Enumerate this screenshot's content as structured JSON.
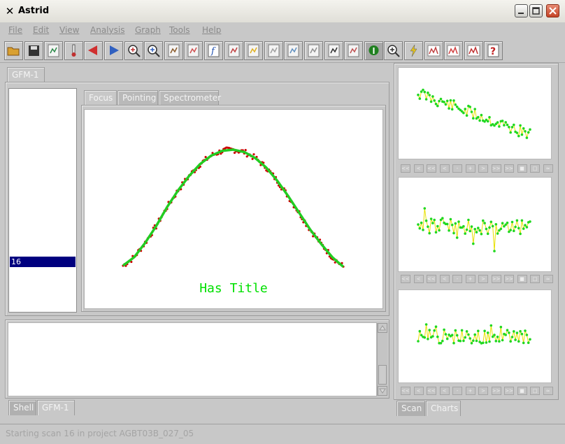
{
  "window": {
    "title": "Astrid",
    "icon": "x-app-icon"
  },
  "menu": [
    "File",
    "Edit",
    "View",
    "Analysis",
    "Graph",
    "Tools",
    "Help"
  ],
  "toolbar_icons": [
    "open-folder-icon",
    "save-disk-icon",
    "export-icon",
    "thermometer-icon",
    "arrow-left-icon",
    "arrow-right-icon",
    "zoom-target-icon",
    "zoom-select-icon",
    "brush-icon",
    "plot-icon",
    "function-icon",
    "fit-icon",
    "annotate-icon",
    "title-icon",
    "edit-icon",
    "print-icon",
    "cursor-icon",
    "erase-icon",
    "info-icon",
    "zoom-icon",
    "lightning-icon",
    "baseline-icon",
    "spectrum-icon",
    "bar-chart-icon",
    "help-icon"
  ],
  "top_tab": "GFM-1",
  "scan_list": {
    "selected": "16"
  },
  "plot_tabs": [
    "Focus",
    "Pointing",
    "Spectrometer"
  ],
  "main_chart": {
    "title": "Has Title",
    "data_color": "#cc0000",
    "fit_color": "#22cc22"
  },
  "bottom_tabs": [
    "Shell",
    "GFM-1"
  ],
  "right_tabs": [
    "Scan",
    "Charts"
  ],
  "nav_buttons": [
    "<<",
    "<",
    "<<",
    "<",
    "-",
    "+",
    ">",
    ">>",
    ">>",
    "■",
    "□",
    "≈"
  ],
  "status": "Starting scan 16 in project AGBT03B_027_05",
  "chart_data": {
    "type": "line",
    "title": "Has Title",
    "series": [
      {
        "x": [
          0.0,
          0.05,
          0.1,
          0.15,
          0.2,
          0.25,
          0.3,
          0.35,
          0.4,
          0.45,
          0.5,
          0.55,
          0.6,
          0.65,
          0.7,
          0.75,
          0.8,
          0.85,
          0.9,
          0.95,
          1.0
        ],
        "y": [
          0.03,
          0.1,
          0.22,
          0.36,
          0.52,
          0.66,
          0.78,
          0.88,
          0.95,
          0.99,
          1.0,
          0.98,
          0.93,
          0.85,
          0.74,
          0.61,
          0.47,
          0.33,
          0.21,
          0.1,
          0.02
        ]
      }
    ]
  }
}
